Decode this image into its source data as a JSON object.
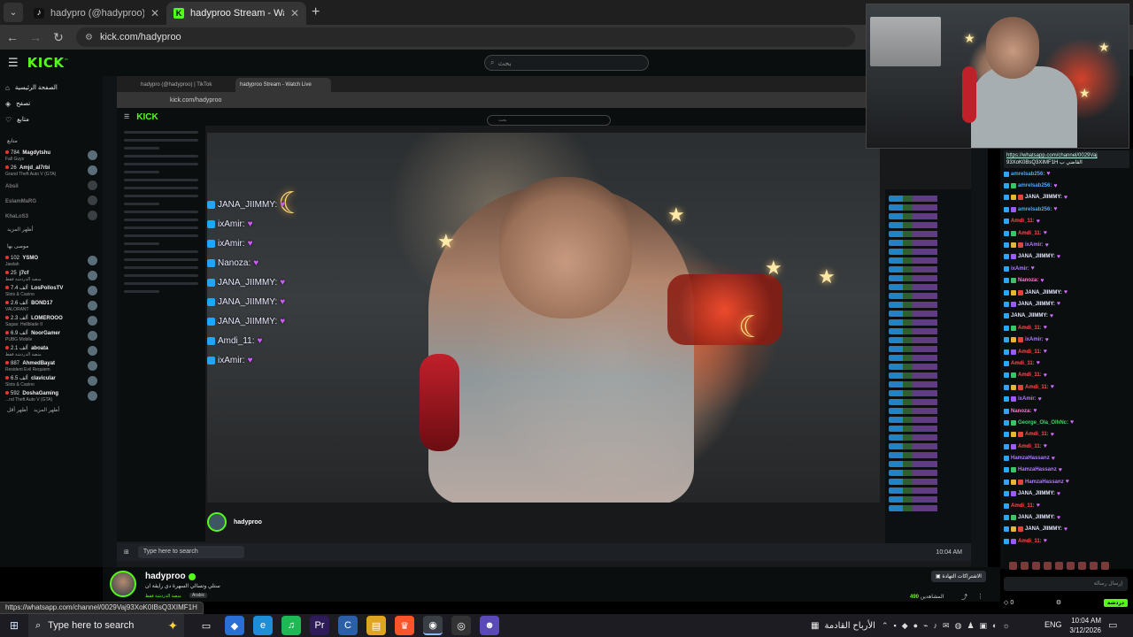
{
  "browser": {
    "tabs": [
      {
        "label": "hadypro (@hadyproo) | TikTok",
        "favicon": "tiktok-icon",
        "active": false
      },
      {
        "label": "hadyproo Stream - Watch Live",
        "favicon": "kick-icon",
        "active": true
      }
    ],
    "url": "kick.com/hadyproo"
  },
  "kick": {
    "logo": "KICK",
    "search_placeholder": "بحث",
    "nav": [
      {
        "label": "الصفحة الرئيسية",
        "icon": "home-icon"
      },
      {
        "label": "تصفح",
        "icon": "compass-icon"
      },
      {
        "label": "متابع",
        "icon": "heart-icon"
      }
    ],
    "following_title": "متابع",
    "following": [
      {
        "viewers": "784",
        "name": "Magdytshu",
        "category": "Fall Guys",
        "live": true
      },
      {
        "viewers": "26",
        "name": "Amjd_al7rbi",
        "category": "Grand Theft Auto V (GTA)",
        "live": true
      },
      {
        "name": "Absil",
        "live": false
      },
      {
        "name": "EslamMaRG",
        "live": false
      },
      {
        "name": "KhaLoS3",
        "live": false
      }
    ],
    "show_more": "أظهر المزيد",
    "recommended_title": "موصى بها",
    "recommended": [
      {
        "viewers": "102",
        "name": "YSMO",
        "category": "Jawlah"
      },
      {
        "viewers": "25",
        "name": "j7cf",
        "category": "منصة الدردشة فقط"
      },
      {
        "viewers": "7.4 ألف",
        "name": "LosPollosTV",
        "category": "Slots & Casino"
      },
      {
        "viewers": "2.6 ألف",
        "name": "BOND17",
        "category": "VALORANT"
      },
      {
        "viewers": "2.3 ألف",
        "name": "LOMEROOO",
        "category": "Sagas: Hellblade II"
      },
      {
        "viewers": "6.9 ألف",
        "name": "NoorGamer",
        "category": "PUBG Mobile"
      },
      {
        "viewers": "2.1 ألف",
        "name": "aboata",
        "category": "منصة الدردشة فقط"
      },
      {
        "viewers": "887",
        "name": "AhmedBayat",
        "category": "Resident Evil Requiem"
      },
      {
        "viewers": "6.5 ألف",
        "name": "clavicular",
        "category": "Slots & Casino"
      },
      {
        "viewers": "592",
        "name": "DoshaGaming",
        "category": "...nd Theft Auto V (GTA)"
      }
    ],
    "show_more_2": "أظهر المزيد",
    "show_less": "أظهر أقل"
  },
  "stream": {
    "streamer": "hadyproo",
    "title": "ستلي وتسالي السهرة دي رايقة ان",
    "category": "منصة الدردشة فقط",
    "language": "Arabic",
    "follow_label": "الاشتراكات التهادة",
    "viewers_label": "المشاهدين",
    "viewers": "490"
  },
  "overlay_chat": [
    "JANA_JIIMMY:",
    "ixAmir:",
    "ixAmir:",
    "Nanoza:",
    "JANA_JIIMMY:",
    "JANA_JIIMMY:",
    "JANA_JIIMMY:",
    "Amdi_11:",
    "ixAmir:"
  ],
  "mirror": {
    "tab1": "hadypro (@hadyproo) | TikTok",
    "tab2": "hadyproo Stream - Watch Live",
    "url": "kick.com/hadyproo",
    "logo": "KICK",
    "search": "بحث",
    "streamer": "hadyproo",
    "taskbar_search": "Type here to search",
    "time": "10:04 AM"
  },
  "chat": {
    "pinned_line1": "https://whatsapp.com/channel/0029Vaj",
    "pinned_line2": "93XoK0BsQ3XIMF1H القاضي ب",
    "messages": [
      {
        "user": "amrelsab256:",
        "color": "#4aa8ff"
      },
      {
        "user": "amrelsab256:",
        "color": "#4aa8ff"
      },
      {
        "user": "JANA_JIIMMY:",
        "color": "#e6e6ff"
      },
      {
        "user": "amrelsab256:",
        "color": "#4aa8ff"
      },
      {
        "user": "Amdi_11:",
        "color": "#ff4d4d"
      },
      {
        "user": "Amdi_11:",
        "color": "#ff4d4d"
      },
      {
        "user": "ixAmir:",
        "color": "#b07aff"
      },
      {
        "user": "JANA_JIIMMY:",
        "color": "#e6e6ff"
      },
      {
        "user": "ixAmir:",
        "color": "#b07aff"
      },
      {
        "user": "Nanoza:",
        "color": "#ff7ad1"
      },
      {
        "user": "JANA_JIIMMY:",
        "color": "#e6e6ff"
      },
      {
        "user": "JANA_JIIMMY:",
        "color": "#e6e6ff"
      },
      {
        "user": "JANA_JIIMMY:",
        "color": "#e6e6ff"
      },
      {
        "user": "Amdi_11:",
        "color": "#ff4d4d"
      },
      {
        "user": "ixAmir:",
        "color": "#b07aff"
      },
      {
        "user": "Amdi_11:",
        "color": "#ff4d4d"
      },
      {
        "user": "Amdi_11:",
        "color": "#ff4d4d"
      },
      {
        "user": "Amdi_11:",
        "color": "#ff4d4d"
      },
      {
        "user": "Amdi_11:",
        "color": "#ff4d4d"
      },
      {
        "user": "ixAmir:",
        "color": "#b07aff"
      },
      {
        "user": "Nanoza:",
        "color": "#ff7ad1"
      },
      {
        "user": "George_Ola_OlhNc:",
        "color": "#44d36a"
      },
      {
        "user": "Amdi_11:",
        "color": "#ff4d4d"
      },
      {
        "user": "Amdi_11:",
        "color": "#ff4d4d"
      },
      {
        "user": "HamzaHassanz",
        "color": "#b07aff"
      },
      {
        "user": "HamzaHassanz",
        "color": "#b07aff"
      },
      {
        "user": "HamzaHassanz",
        "color": "#b07aff"
      },
      {
        "user": "JANA_JIIMMY:",
        "color": "#e6e6ff"
      },
      {
        "user": "Amdi_11:",
        "color": "#ff4d4d"
      },
      {
        "user": "JANA_JIIMMY:",
        "color": "#e6e6ff"
      },
      {
        "user": "JANA_JIIMMY:",
        "color": "#e6e6ff"
      },
      {
        "user": "Amdi_11:",
        "color": "#ff4d4d"
      }
    ],
    "input_placeholder": "إرسال رسالة",
    "points": "0",
    "send_label": "دردشة"
  },
  "status_url": "https://whatsapp.com/channel/0029Vaj93XoK0IBsQ3XIMF1H",
  "taskbar": {
    "search_placeholder": "Type here to search",
    "weather": "الأرباح القادمة",
    "lang": "ENG",
    "time": "10:04 AM",
    "date": "3/12/2026"
  },
  "colors": {
    "kick_green": "#53fc18",
    "bg": "#0b0e0f"
  }
}
